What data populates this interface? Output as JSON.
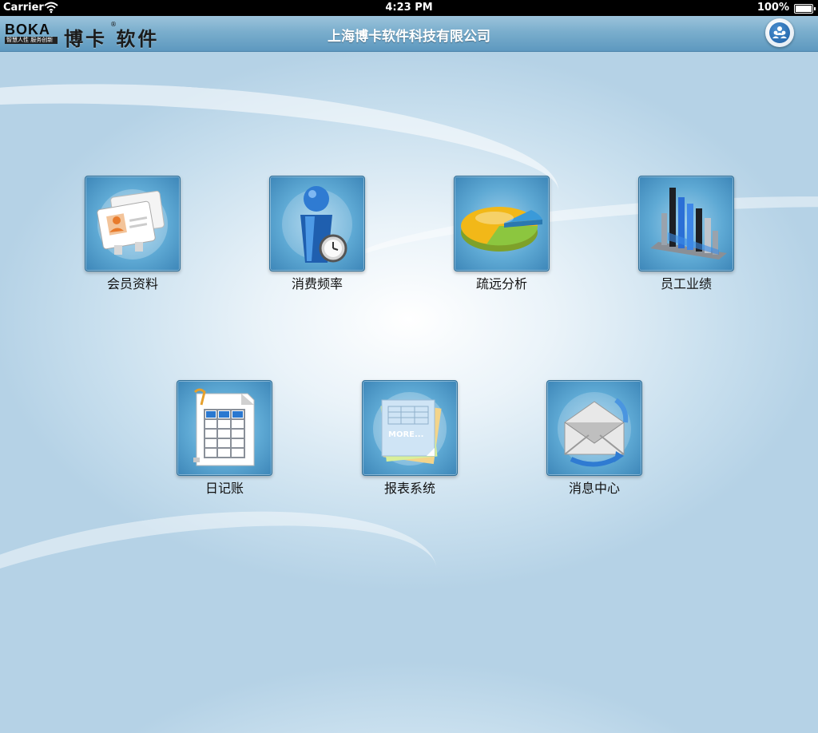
{
  "status_bar": {
    "carrier": "Carrier",
    "time": "4:23 PM",
    "battery": "100%"
  },
  "header": {
    "logo_text": "BOKA",
    "logo_slogan": "智慧人性 服务创新",
    "brand_name": "博卡 软件",
    "brand_reg": "®",
    "title": "上海博卡软件科技有限公司",
    "user_icon": "users-icon"
  },
  "launcher": {
    "items": [
      {
        "label": "会员资料",
        "icon": "member-card-icon"
      },
      {
        "label": "消费频率",
        "icon": "person-clock-icon"
      },
      {
        "label": "疏远分析",
        "icon": "pie-chart-icon"
      },
      {
        "label": "员工业绩",
        "icon": "bar-chart-icon"
      },
      {
        "label": "日记账",
        "icon": "ledger-icon"
      },
      {
        "label": "报表系统",
        "icon": "reports-icon"
      },
      {
        "label": "消息中心",
        "icon": "envelope-icon"
      }
    ],
    "reports_badge": "MORE..."
  },
  "colors": {
    "header_top": "#9cc3db",
    "header_bottom": "#5d98bf",
    "tile_center": "#9fd0ec",
    "tile_edge": "#3d86b8",
    "background": "#c8dfee"
  }
}
